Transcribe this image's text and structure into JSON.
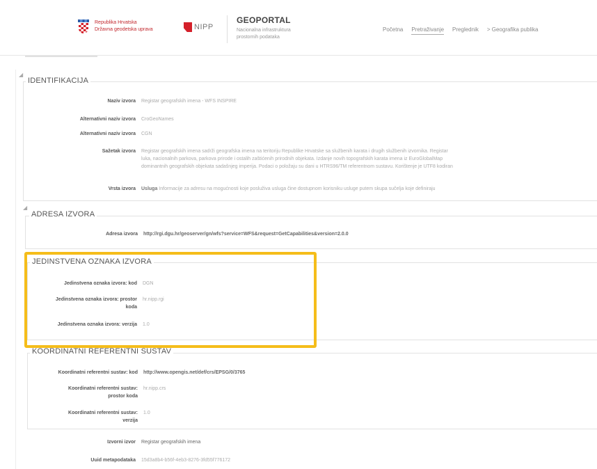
{
  "header": {
    "dgu_logo_line1": "Republika Hrvatska",
    "dgu_logo_line2": "Državna geodetska uprava",
    "nipp_logo": "NIPP",
    "brand_title": "GEOPORTAL",
    "brand_sub_line1": "Nacionalna infrastruktura",
    "brand_sub_line2": "prostornih podataka",
    "nav": [
      {
        "label": "Početna"
      },
      {
        "label": "Pretraživanje"
      },
      {
        "label": "Preglednik"
      },
      {
        "label": "> Geografika publika"
      }
    ]
  },
  "identifikacija": {
    "title": "IDENTIFIKACIJA",
    "rows": [
      {
        "label": "Naziv izvora",
        "value": "Registar geografskih imena - WFS INSPIRE"
      },
      {
        "label": "Alternativni naziv izvora",
        "value": "CroGeoNames"
      },
      {
        "label": "Alternativni naziv izvora",
        "value": "CGN"
      },
      {
        "label": "Sažetak izvora",
        "line1": "Registar geografskih imena sadrži geografska imena na teritoriju Republike Hrvatske sa službenih karata i drugih službenih izvornika. Registar",
        "line2": "luka, nacionalnih parkova, parkova prirode i ostalih zaštićenih prirodnih objekata. Izdanje novih topografskih karata imena iz EuroGlobalMap",
        "line3": "dominantnih geografskih objekata sadašnjeg imperija. Podaci o položaju su dani u HTRS96/TM referentnom sustavu. Korištenje je UTF8 kodiran"
      },
      {
        "label": "Vrsta izvora",
        "value_bold": "Usluga",
        "value": "Informacije za adresu na mogućnosti koje posluživa usluga čine dostupnom korisniku usluge putem skupa sučelja koje definiraju"
      }
    ]
  },
  "adresa": {
    "title": "ADRESA IZVORA",
    "label": "Adresa izvora",
    "value": "http://rgi.dgu.hr/geoserver/gn/wfs?service=WFS&request=GetCapabilities&version=2.0.0"
  },
  "oznaka": {
    "title": "JEDINSTVENA OZNAKA IZVORA",
    "rows": [
      {
        "label": "Jedinstvena oznaka izvora: kod",
        "value": "DGN"
      },
      {
        "label_line1": "Jedinstvena oznaka izvora: prostor",
        "label_line2": "koda",
        "value": "hr.nipp.rgi"
      },
      {
        "label": "Jedinstvena oznaka izvora: verzija",
        "value": "1.0"
      }
    ]
  },
  "koordinatni": {
    "title": "KOORDINATNI REFERENTNI SUSTAV",
    "rows": [
      {
        "label": "Koordinatni referentni sustav: kod",
        "value": "http://www.opengis.net/def/crs/EPSG/0/3765"
      },
      {
        "label_line1": "Koordinatni referentni sustav:",
        "label_line2": "prostor koda",
        "value": "hr.nipp.crs"
      },
      {
        "label_line1": "Koordinatni referentni sustav:",
        "label_line2": "verzija",
        "value": "1.0"
      }
    ]
  },
  "footer_rows": [
    {
      "label": "Izvorni izvor",
      "value": "Registar geografskih imena"
    },
    {
      "label": "Uuid metapodataka",
      "value": "15d3a8b4-b56f-4eb3-8276-3fd55f776172"
    }
  ],
  "colors": {
    "highlight": "#f5bd1a",
    "dgu_red": "#c2272d"
  }
}
